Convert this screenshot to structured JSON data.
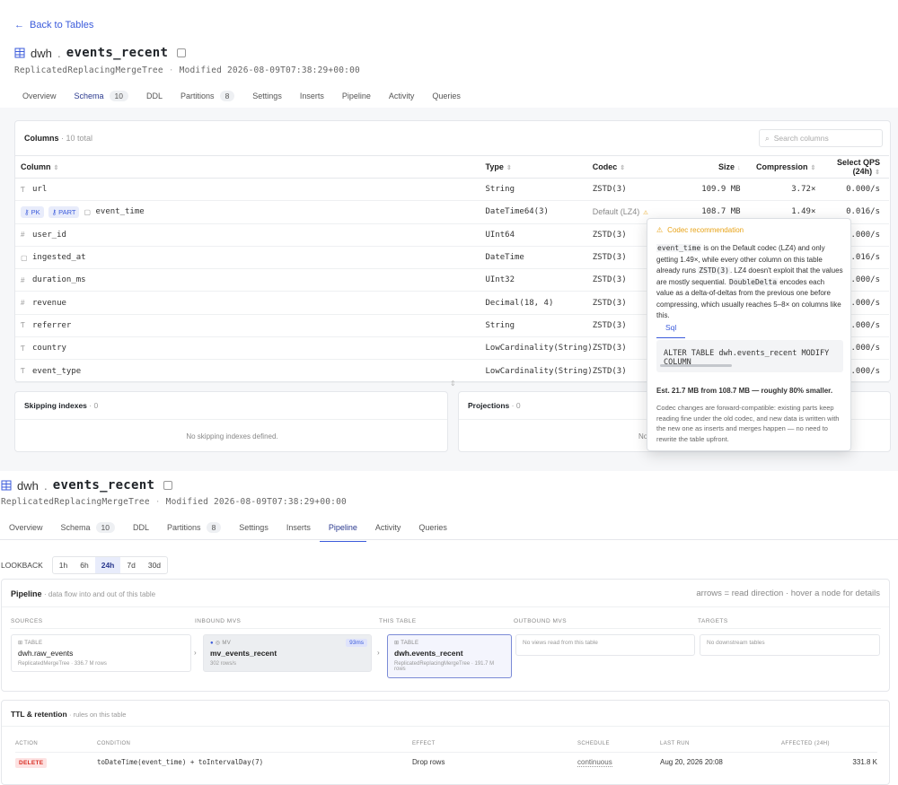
{
  "top": {
    "back_label": "Back to Tables",
    "db": "dwh",
    "table": "events_recent",
    "engine": "ReplicatedReplacingMergeTree",
    "modified": "Modified 2026-08-09T07:38:29+00:00",
    "tabs": [
      {
        "label": "Overview",
        "badge": ""
      },
      {
        "label": "Schema",
        "badge": "10"
      },
      {
        "label": "DDL",
        "badge": ""
      },
      {
        "label": "Partitions",
        "badge": "8"
      },
      {
        "label": "Settings",
        "badge": ""
      },
      {
        "label": "Inserts",
        "badge": ""
      },
      {
        "label": "Pipeline",
        "badge": ""
      },
      {
        "label": "Activity",
        "badge": ""
      },
      {
        "label": "Queries",
        "badge": ""
      }
    ],
    "active_tab": "Schema",
    "columns_card": {
      "title": "Columns",
      "subtitle": "· 10 total",
      "search_placeholder": "Search columns",
      "headers": [
        "Column",
        "Type",
        "Codec",
        "Size",
        "Compression",
        "Select QPS (24h)"
      ],
      "rows": [
        {
          "icon": "T",
          "name": "url",
          "pk": false,
          "part": false,
          "type": "String",
          "codec": "ZSTD(3)",
          "size": "109.9 MB",
          "compression": "3.72×",
          "qps": "0.000/s"
        },
        {
          "icon": "cal",
          "name": "event_time",
          "pk": true,
          "part": true,
          "type": "DateTime64(3)",
          "codec": "Default (LZ4)",
          "codec_warn": true,
          "size": "108.7 MB",
          "compression": "1.49×",
          "qps": "0.016/s"
        },
        {
          "icon": "#",
          "name": "user_id",
          "pk": false,
          "part": false,
          "type": "UInt64",
          "codec": "ZSTD(3)",
          "size": "",
          "compression": "",
          "qps": ".000/s"
        },
        {
          "icon": "cal",
          "name": "ingested_at",
          "pk": false,
          "part": false,
          "type": "DateTime",
          "codec": "ZSTD(3)",
          "size": "",
          "compression": "",
          "qps": ".016/s"
        },
        {
          "icon": "#",
          "name": "duration_ms",
          "pk": false,
          "part": false,
          "type": "UInt32",
          "codec": "ZSTD(3)",
          "size": "",
          "compression": "",
          "qps": ".000/s"
        },
        {
          "icon": "#",
          "name": "revenue",
          "pk": false,
          "part": false,
          "type": "Decimal(18, 4)",
          "codec": "ZSTD(3)",
          "size": "",
          "compression": "",
          "qps": ".000/s"
        },
        {
          "icon": "T",
          "name": "referrer",
          "pk": false,
          "part": false,
          "type": "String",
          "codec": "ZSTD(3)",
          "size": "",
          "compression": "",
          "qps": ".000/s"
        },
        {
          "icon": "T",
          "name": "country",
          "pk": false,
          "part": false,
          "type": "LowCardinality(String)",
          "codec": "ZSTD(3)",
          "size": "",
          "compression": "",
          "qps": ".000/s"
        },
        {
          "icon": "T",
          "name": "event_type",
          "pk": false,
          "part": false,
          "type": "LowCardinality(String)",
          "codec": "ZSTD(3)",
          "size": "",
          "compression": "",
          "qps": ".000/s"
        }
      ],
      "pk_label": "PK",
      "part_label": "PART"
    },
    "skipping": {
      "title": "Skipping indexes",
      "count": "· 0",
      "empty": "No skipping indexes defined."
    },
    "projections": {
      "title": "Projections",
      "count": "· 0",
      "empty": "No"
    },
    "popover": {
      "title": "Codec recommendation",
      "p1": "event_time",
      "p2": " is on the Default codec (LZ4) and only getting 1.49×, while every other column on this table already runs ",
      "p3": "ZSTD(3)",
      "p4": ". LZ4 doesn't exploit that the values are mostly sequential. ",
      "p5": "DoubleDelta",
      "p6": " encodes each value as a delta-of-deltas from the previous one before compressing, which usually reaches 5–8× on columns like this.",
      "sql_tab": "Sql",
      "sql": "ALTER TABLE dwh.events_recent MODIFY COLUMN",
      "estimate": "Est. 21.7 MB from 108.7 MB — roughly 80% smaller.",
      "note": "Codec changes are forward-compatible: existing parts keep reading fine under the old codec, and new data is written with the new one as inserts and merges happen — no need to rewrite the table upfront."
    }
  },
  "bottom": {
    "db": "dwh",
    "table": "events_recent",
    "engine": "ReplicatedReplacingMergeTree",
    "modified": "Modified 2026-08-09T07:38:29+00:00",
    "tabs": [
      {
        "label": "Overview",
        "badge": ""
      },
      {
        "label": "Schema",
        "badge": "10"
      },
      {
        "label": "DDL",
        "badge": ""
      },
      {
        "label": "Partitions",
        "badge": "8"
      },
      {
        "label": "Settings",
        "badge": ""
      },
      {
        "label": "Inserts",
        "badge": ""
      },
      {
        "label": "Pipeline",
        "badge": ""
      },
      {
        "label": "Activity",
        "badge": ""
      },
      {
        "label": "Queries",
        "badge": ""
      }
    ],
    "active_tab": "Pipeline",
    "lookback": {
      "label": "LOOKBACK",
      "options": [
        "1h",
        "6h",
        "24h",
        "7d",
        "30d"
      ],
      "active": "24h"
    },
    "pipeline": {
      "title": "Pipeline",
      "subtitle": "· data flow into and out of this table",
      "hint": "arrows = read direction · hover a node for details",
      "sections": [
        "SOURCES",
        "INBOUND MVS",
        "THIS TABLE",
        "OUTBOUND MVS",
        "TARGETS"
      ],
      "source": {
        "kind": "TABLE",
        "name": "dwh.raw_events",
        "meta": "ReplicatedMergeTree · 336.7 M rows"
      },
      "mv": {
        "kind": "MV",
        "name": "mv_events_recent",
        "meta": "302 rows/s",
        "lag": "93ms"
      },
      "this": {
        "kind": "TABLE",
        "name": "dwh.events_recent",
        "meta": "ReplicatedReplacingMergeTree · 191.7 M rows"
      },
      "outbound_empty": "No views read from this table",
      "targets_empty": "No downstream tables"
    },
    "ttl": {
      "title": "TTL & retention",
      "subtitle": "· rules on this table",
      "headers": [
        "ACTION",
        "CONDITION",
        "EFFECT",
        "SCHEDULE",
        "LAST RUN",
        "AFFECTED (24H)"
      ],
      "row": {
        "action": "DELETE",
        "condition": "toDateTime(event_time) + toIntervalDay(7)",
        "effect": "Drop rows",
        "schedule": "continuous",
        "last_run": "Aug 20, 2026 20:08",
        "affected": "331.8 K"
      }
    }
  },
  "colors": {
    "accent": "#3b5bdb",
    "warn": "#e8a317",
    "danger": "#d93025"
  }
}
